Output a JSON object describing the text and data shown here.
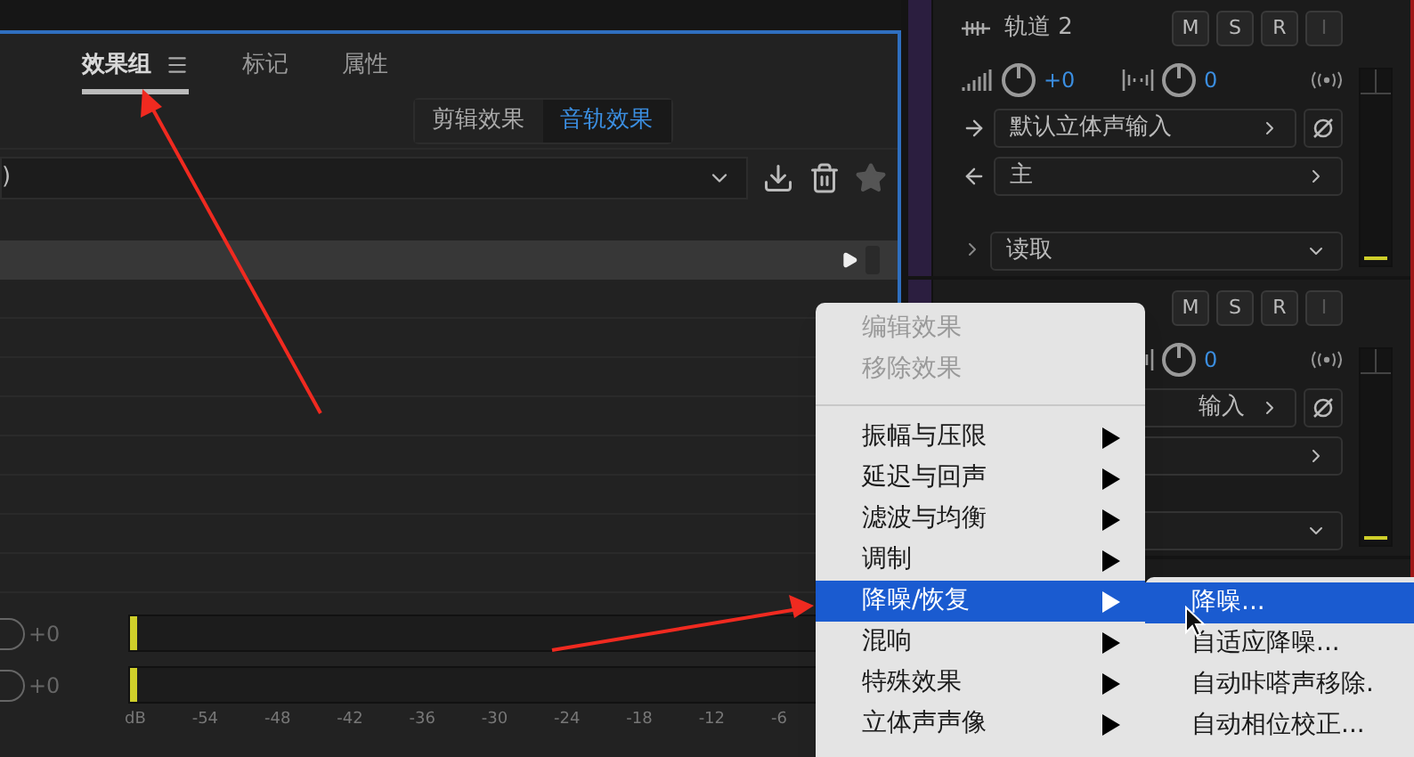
{
  "tabs": [
    {
      "label": "效果组",
      "selected": true
    },
    {
      "label": "标记",
      "selected": false
    },
    {
      "label": "属性",
      "selected": false
    }
  ],
  "rack_tabs": [
    {
      "label": "剪辑效果",
      "selected": false
    },
    {
      "label": "音轨效果",
      "selected": true
    }
  ],
  "preset": {
    "value": ")"
  },
  "channels": [
    {
      "reading": "+0",
      "level": 0.01
    },
    {
      "reading": "+0",
      "level": 0.01
    }
  ],
  "meter_scale": [
    "dB",
    "-54",
    "-48",
    "-42",
    "-36",
    "-30",
    "-24",
    "-18",
    "-12",
    "-6"
  ],
  "tracks": [
    {
      "name": "轨道 2",
      "buttons": [
        {
          "label": "M",
          "disabled": false
        },
        {
          "label": "S",
          "disabled": false
        },
        {
          "label": "R",
          "disabled": false
        },
        {
          "label": "I",
          "disabled": true
        }
      ],
      "volume": "+0",
      "pan": "0",
      "input": "默认立体声输入",
      "output": "主",
      "automation": "读取"
    },
    {
      "buttons": [
        {
          "label": "M",
          "disabled": false
        },
        {
          "label": "S",
          "disabled": false
        },
        {
          "label": "R",
          "disabled": false
        },
        {
          "label": "I",
          "disabled": true
        }
      ],
      "pan": "0",
      "input": "输入"
    }
  ],
  "context_menu": {
    "items": [
      {
        "kind": "item",
        "label": "编辑效果",
        "disabled": true,
        "submenu": false,
        "selected": false
      },
      {
        "kind": "item",
        "label": "移除效果",
        "disabled": true,
        "submenu": false,
        "selected": false
      },
      {
        "kind": "separator"
      },
      {
        "kind": "item",
        "label": "振幅与压限",
        "disabled": false,
        "submenu": true,
        "selected": false
      },
      {
        "kind": "item",
        "label": "延迟与回声",
        "disabled": false,
        "submenu": true,
        "selected": false
      },
      {
        "kind": "item",
        "label": "滤波与均衡",
        "disabled": false,
        "submenu": true,
        "selected": false
      },
      {
        "kind": "item",
        "label": "调制",
        "disabled": false,
        "submenu": true,
        "selected": false
      },
      {
        "kind": "item",
        "label": "降噪/恢复",
        "disabled": false,
        "submenu": true,
        "selected": true
      },
      {
        "kind": "item",
        "label": "混响",
        "disabled": false,
        "submenu": true,
        "selected": false
      },
      {
        "kind": "item",
        "label": "特殊效果",
        "disabled": false,
        "submenu": true,
        "selected": false
      },
      {
        "kind": "item",
        "label": "立体声声像",
        "disabled": false,
        "submenu": true,
        "selected": false
      }
    ]
  },
  "submenu": {
    "items": [
      {
        "label": "降噪...",
        "selected": true
      },
      {
        "label": "自适应降噪...",
        "selected": false
      },
      {
        "label": "自动咔嗒声移除.",
        "selected": false
      },
      {
        "label": "自动相位校正...",
        "selected": false
      }
    ]
  }
}
